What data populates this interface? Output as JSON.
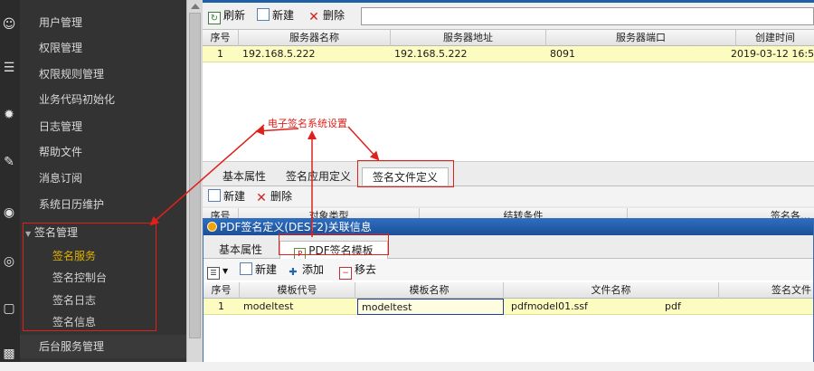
{
  "sidebar": {
    "items": [
      {
        "label": "用户管理",
        "kind": "item"
      },
      {
        "label": "权限管理",
        "kind": "item"
      },
      {
        "label": "权限规则管理",
        "kind": "item"
      },
      {
        "label": "业务代码初始化",
        "kind": "item"
      },
      {
        "label": "日志管理",
        "kind": "item"
      },
      {
        "label": "帮助文件",
        "kind": "item"
      },
      {
        "label": "消息订阅",
        "kind": "item"
      },
      {
        "label": "系统日历维护",
        "kind": "item"
      },
      {
        "label": "签名管理",
        "kind": "group",
        "expanded": true
      },
      {
        "label": "签名服务",
        "kind": "sub",
        "selected": true
      },
      {
        "label": "签名控制台",
        "kind": "sub"
      },
      {
        "label": "签名日志",
        "kind": "sub"
      },
      {
        "label": "签名信息",
        "kind": "sub"
      },
      {
        "label": "后台服务管理",
        "kind": "item"
      }
    ]
  },
  "toolbar": {
    "refresh_label": "刷新",
    "new_label": "新建",
    "delete_label": "删除",
    "search_value": ""
  },
  "server_grid": {
    "columns": [
      "序号",
      "服务器名称",
      "服务器地址",
      "服务器端口",
      "创建时间"
    ],
    "rows": [
      [
        "1",
        "192.168.5.222",
        "192.168.5.222",
        "8091",
        "2019-03-12 16:5"
      ]
    ]
  },
  "lower_tabs": {
    "tabs": [
      {
        "label": "基本属性",
        "active": false
      },
      {
        "label": "签名应用定义",
        "active": false
      },
      {
        "label": "签名文件定义",
        "active": true
      }
    ],
    "new_label": "新建",
    "delete_label": "删除",
    "grid_columns_partial": [
      "序号",
      "对象类型",
      "结转条件",
      "签名各…"
    ]
  },
  "dialog": {
    "title": "PDF签名定义(DESF2)关联信息",
    "tabs": [
      {
        "label": "基本属性",
        "active": false
      },
      {
        "label": "PDF签名模板",
        "active": true
      }
    ],
    "toolbar": {
      "new_label": "新建",
      "add_label": "添加",
      "remove_label": "移去"
    },
    "grid": {
      "columns": [
        "序号",
        "模板代号",
        "模板名称",
        "文件名称",
        "签名文件"
      ],
      "rows": [
        [
          "1",
          "modeltest",
          "modeltest",
          "pdfmodel01.ssf",
          "pdf"
        ]
      ]
    }
  },
  "annotation": {
    "text": "电子签名系统设置",
    "color": "#e0201a"
  },
  "colors": {
    "sidebar_bg": "#333333",
    "selected_row": "#fdfcc0",
    "accent_blue": "#1f5fa5",
    "highlight_text": "#e0b000"
  }
}
